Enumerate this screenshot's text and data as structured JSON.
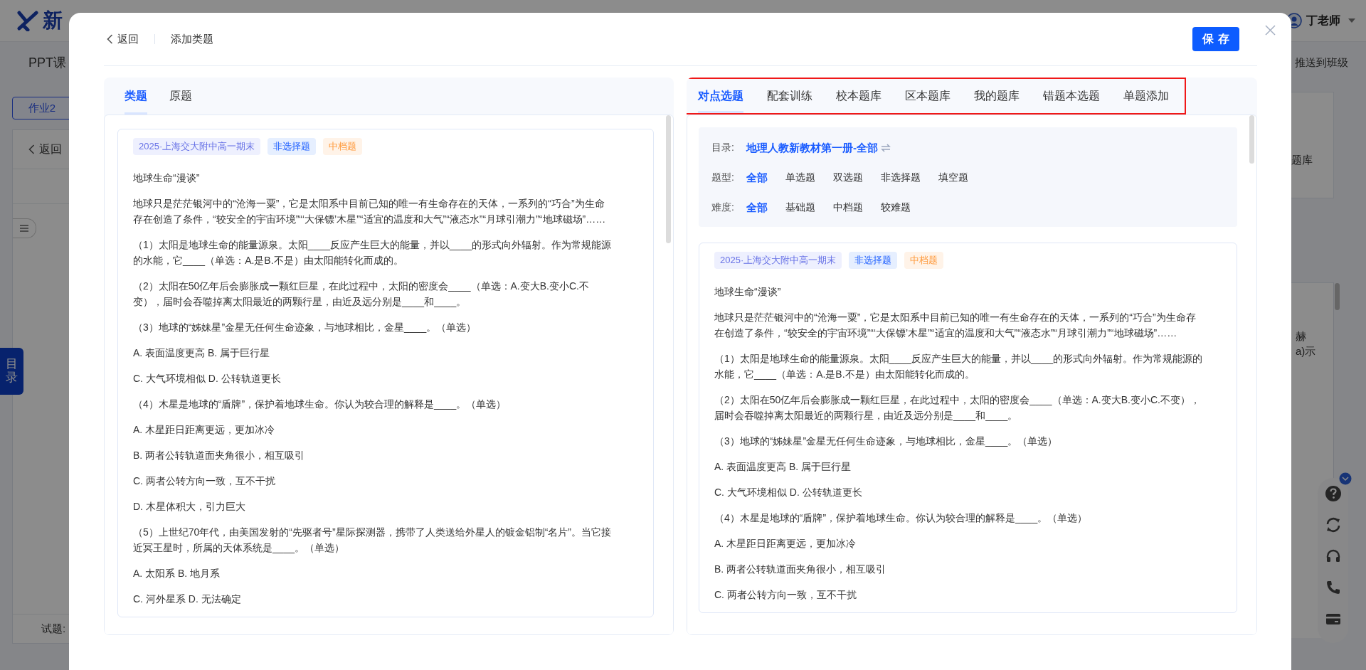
{
  "background": {
    "logo_text": "新",
    "user_name": "丁老师",
    "nav_tab": "PPT课",
    "push_button": "推送到班级",
    "homework_tab": "作业2",
    "back_link": "返回",
    "side_tab": "目录",
    "footer_label": "试题:",
    "library_fragment": "题库",
    "text_fragments": [
      "赫",
      "a)示"
    ]
  },
  "modal": {
    "back_link": "返回",
    "title": "添加类题",
    "save_button": "保存",
    "left_panel": {
      "tabs": [
        {
          "label": "类题",
          "selected": true
        },
        {
          "label": "原题",
          "selected": false
        }
      ],
      "question": {
        "tags": [
          {
            "kind": "source",
            "label": "2025·上海交大附中高一期末"
          },
          {
            "kind": "type",
            "label": "非选择题"
          },
          {
            "kind": "difficulty",
            "label": "中档题"
          }
        ],
        "paragraphs": [
          "地球生命“漫谈”",
          "地球只是茫茫银河中的“沧海一粟”，它是太阳系中目前已知的唯一有生命存在的天体，一系列的“巧合”为生命存在创造了条件，“较安全的宇宙环境”“‘大保镖’木星”“适宜的温度和大气”“液态水”“月球引潮力”“地球磁场”……",
          "（1）太阳是地球生命的能量源泉。太阳____反应产生巨大的能量，并以____的形式向外辐射。作为常规能源的水能，它____（单选：A.是B.不是）由太阳能转化而成的。",
          "（2）太阳在50亿年后会膨胀成一颗红巨星，在此过程中，太阳的密度会____（单选：A.变大B.变小C.不变），届时会吞噬掉离太阳最近的两颗行星，由近及远分别是____和____。",
          "（3）地球的“姊妹星”金星无任何生命迹象，与地球相比，金星____。（单选）",
          "A. 表面温度更高 B. 属于巨行星",
          "C. 大气环境相似 D. 公转轨道更长",
          "（4）木星是地球的“盾牌”，保护着地球生命。你认为较合理的解释是____。（单选）",
          "A. 木星距日距离更远，更加冰冷",
          "B. 两者公转轨道面夹角很小，相互吸引",
          "C. 两者公转方向一致，互不干扰",
          "D. 木星体积大，引力巨大",
          "（5）上世纪70年代，由美国发射的“先驱者号”星际探测器，携带了人类送给外星人的镀金铝制“名片”。当它接近冥王星时，所属的天体系统是____。（单选）",
          "A. 太阳系 B. 地月系",
          "C. 河外星系 D. 无法确定"
        ]
      }
    },
    "right_panel": {
      "highlighted": true,
      "tabs": [
        {
          "label": "对点选题",
          "selected": true
        },
        {
          "label": "配套训练",
          "selected": false
        },
        {
          "label": "校本题库",
          "selected": false
        },
        {
          "label": "区本题库",
          "selected": false
        },
        {
          "label": "我的题库",
          "selected": false
        },
        {
          "label": "错题本选题",
          "selected": false
        },
        {
          "label": "单题添加",
          "selected": false
        }
      ],
      "filters": [
        {
          "kind": "catalog",
          "label": "目录:",
          "value": "地理人教新教材第一册-全部"
        },
        {
          "kind": "options",
          "label": "题型:",
          "options": [
            {
              "label": "全部",
              "selected": true
            },
            {
              "label": "单选题",
              "selected": false
            },
            {
              "label": "双选题",
              "selected": false
            },
            {
              "label": "非选择题",
              "selected": false
            },
            {
              "label": "填空题",
              "selected": false
            }
          ]
        },
        {
          "kind": "options",
          "label": "难度:",
          "options": [
            {
              "label": "全部",
              "selected": true
            },
            {
              "label": "基础题",
              "selected": false
            },
            {
              "label": "中档题",
              "selected": false
            },
            {
              "label": "较难题",
              "selected": false
            }
          ]
        }
      ],
      "question": {
        "tags": [
          {
            "kind": "source",
            "label": "2025·上海交大附中高一期末"
          },
          {
            "kind": "type",
            "label": "非选择题"
          },
          {
            "kind": "difficulty",
            "label": "中档题"
          }
        ],
        "paragraphs": [
          "地球生命“漫谈”",
          "地球只是茫茫银河中的“沧海一粟”，它是太阳系中目前已知的唯一有生命存在的天体，一系列的“巧合”为生命存在创造了条件，“较安全的宇宙环境”“‘大保镖’木星”“适宜的温度和大气”“液态水”“月球引潮力”“地球磁场”……",
          "（1）太阳是地球生命的能量源泉。太阳____反应产生巨大的能量，并以____的形式向外辐射。作为常规能源的水能，它____（单选：A.是B.不是）由太阳能转化而成的。",
          "（2）太阳在50亿年后会膨胀成一颗红巨星，在此过程中，太阳的密度会____（单选：A.变大B.变小C.不变），届时会吞噬掉离太阳最近的两颗行星，由近及远分别是____和____。",
          "（3）地球的“姊妹星”金星无任何生命迹象，与地球相比，金星____。（单选）",
          "A. 表面温度更高 B. 属于巨行星",
          "C. 大气环境相似 D. 公转轨道更长",
          "（4）木星是地球的“盾牌”，保护着地球生命。你认为较合理的解释是____。（单选）",
          "A. 木星距日距离更远，更加冰冷",
          "B. 两者公转轨道面夹角很小，相互吸引",
          "C. 两者公转方向一致，互不干扰"
        ]
      }
    }
  }
}
